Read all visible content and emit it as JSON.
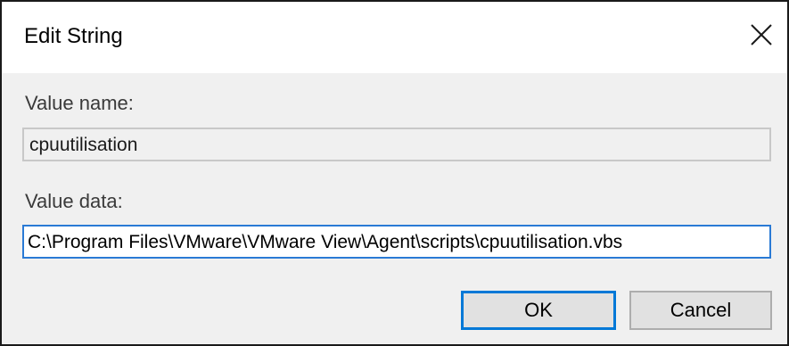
{
  "dialog": {
    "title": "Edit String",
    "close_icon": "close-icon"
  },
  "value_name": {
    "label": "Value name:",
    "value": "cpuutilisation"
  },
  "value_data": {
    "label": "Value data:",
    "value": "C:\\Program Files\\VMware\\VMware View\\Agent\\scripts\\cpuutilisation.vbs"
  },
  "buttons": {
    "ok_label": "OK",
    "cancel_label": "Cancel"
  },
  "colors": {
    "focus_border": "#0078d7",
    "dialog_body": "#f0f0f0",
    "titlebar": "#ffffff"
  }
}
